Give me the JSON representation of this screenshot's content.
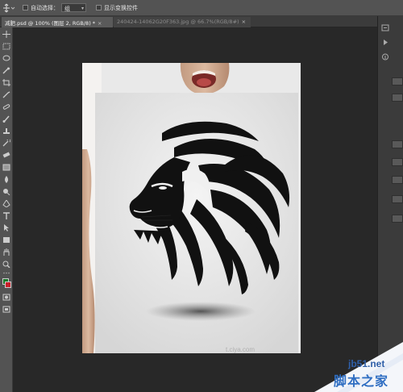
{
  "options_bar": {
    "auto_select_label": "自动选择：",
    "auto_select_value": "组",
    "show_transform_label": "显示变换控件"
  },
  "tabs": [
    {
      "label": "减肥.psd @ 100% (图层 2, RGB/8) *",
      "close": "×",
      "active": true
    },
    {
      "label": "240424-14062G20F363.jpg @ 66.7%(RGB/8#)",
      "close": "×",
      "active": false
    }
  ],
  "canvas": {
    "front_image_caption": "t.ciya.com"
  },
  "colors": {
    "foreground": "#1a7a2a",
    "background": "#c8202a",
    "app_chrome": "#535353",
    "canvas_bg": "#282828"
  },
  "tool_icons": [
    "move-icon",
    "marquee-icon",
    "lasso-icon",
    "quick-select-icon",
    "crop-icon",
    "eyedropper-icon",
    "healing-icon",
    "brush-icon",
    "clone-stamp-icon",
    "history-brush-icon",
    "eraser-icon",
    "gradient-icon",
    "blur-icon",
    "dodge-icon",
    "pen-icon",
    "type-icon",
    "path-select-icon",
    "shape-icon",
    "hand-icon",
    "zoom-icon"
  ],
  "watermark": {
    "site": "jb51.net",
    "name": "脚本之家"
  }
}
